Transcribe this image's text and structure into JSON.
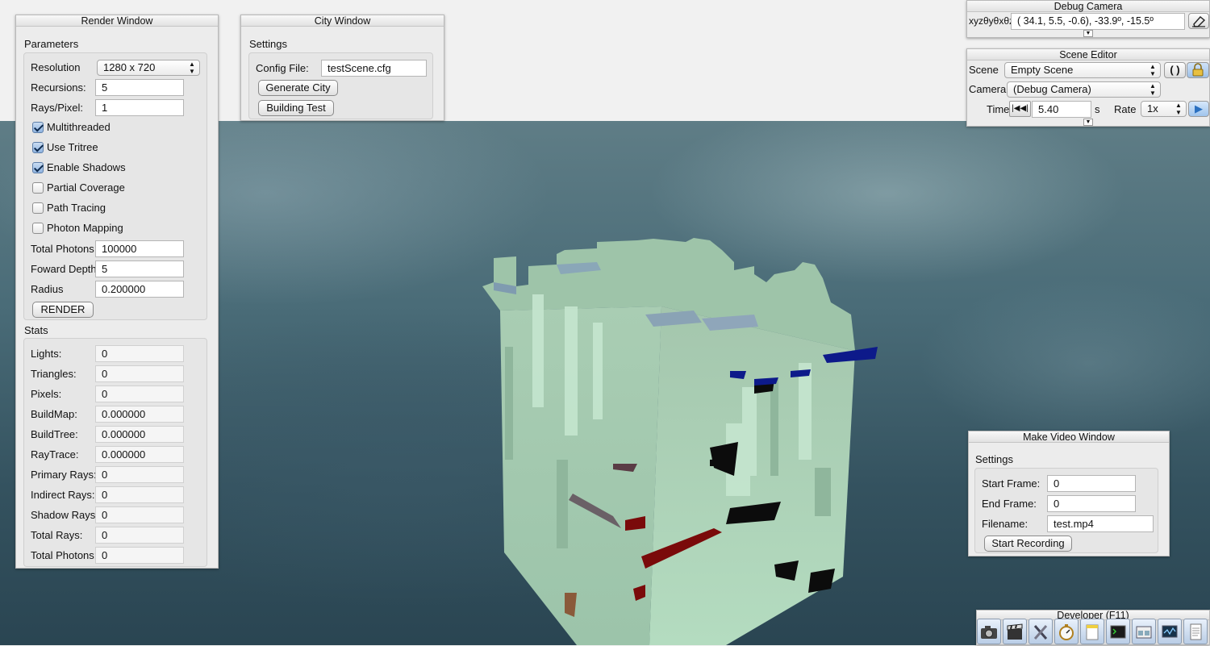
{
  "render_window": {
    "title": "Render Window",
    "parameters_title": "Parameters",
    "resolution": {
      "label": "Resolution",
      "value": "1280 x 720"
    },
    "recursions": {
      "label": "Recursions:",
      "value": "5"
    },
    "rays_per_pixel": {
      "label": "Rays/Pixel:",
      "value": "1"
    },
    "checkboxes": [
      {
        "label": "Multithreaded",
        "checked": true
      },
      {
        "label": "Use Tritree",
        "checked": true
      },
      {
        "label": "Enable Shadows",
        "checked": true
      },
      {
        "label": "Partial Coverage",
        "checked": false
      },
      {
        "label": "Path Tracing",
        "checked": false
      },
      {
        "label": "Photon Mapping",
        "checked": false
      }
    ],
    "total_photons": {
      "label": "Total Photons",
      "value": "100000"
    },
    "foward_depth": {
      "label": "Foward Depth",
      "value": "5"
    },
    "radius": {
      "label": "Radius",
      "value": "0.200000"
    },
    "render_button": "RENDER",
    "stats_title": "Stats",
    "stats": [
      {
        "label": "Lights:",
        "value": "0"
      },
      {
        "label": "Triangles:",
        "value": "0"
      },
      {
        "label": "Pixels:",
        "value": "0"
      },
      {
        "label": "BuildMap:",
        "value": "0.000000"
      },
      {
        "label": "BuildTree:",
        "value": "0.000000"
      },
      {
        "label": "RayTrace:",
        "value": "0.000000"
      },
      {
        "label": "Primary Rays:",
        "value": "0"
      },
      {
        "label": "Indirect Rays:",
        "value": "0"
      },
      {
        "label": "Shadow Rays:",
        "value": "0"
      },
      {
        "label": "Total Rays:",
        "value": "0"
      },
      {
        "label": "Total Photons:",
        "value": "0"
      }
    ]
  },
  "city_window": {
    "title": "City Window",
    "settings_title": "Settings",
    "config_label": "Config File:",
    "config_value": "testScene.cfg",
    "generate_button": "Generate City",
    "building_button": "Building Test"
  },
  "debug_camera": {
    "title": "Debug Camera",
    "label": "xyzθyθxθz",
    "value": "( 34.1,    5.5,  -0.6), -33.9º, -15.5º"
  },
  "scene_editor": {
    "title": "Scene Editor",
    "scene_label": "Scene",
    "scene_value": "Empty Scene",
    "camera_label": "Camera",
    "camera_value": "(Debug Camera)",
    "time_label": "Time",
    "time_value": "5.40",
    "time_unit": "s",
    "rate_label": "Rate",
    "rate_value": "1x"
  },
  "make_video_window": {
    "title": "Make Video Window",
    "settings_title": "Settings",
    "start_frame": {
      "label": "Start Frame:",
      "value": "0"
    },
    "end_frame": {
      "label": "End Frame:",
      "value": "0"
    },
    "filename": {
      "label": "Filename:",
      "value": "test.mp4"
    },
    "record_button": "Start Recording"
  },
  "developer": {
    "title": "Developer (F11)",
    "tools": [
      "camera-icon",
      "clapperboard-icon",
      "tools-icon",
      "stopwatch-icon",
      "notepad-icon",
      "terminal-icon",
      "windows-icon",
      "monitor-graph-icon",
      "document-icon"
    ]
  },
  "colors": {
    "sky_dark": "#2a4552",
    "building_face": "#b6dcc0",
    "building_shade": "#8fb59c",
    "accent_blue": "#6aa8e0"
  }
}
